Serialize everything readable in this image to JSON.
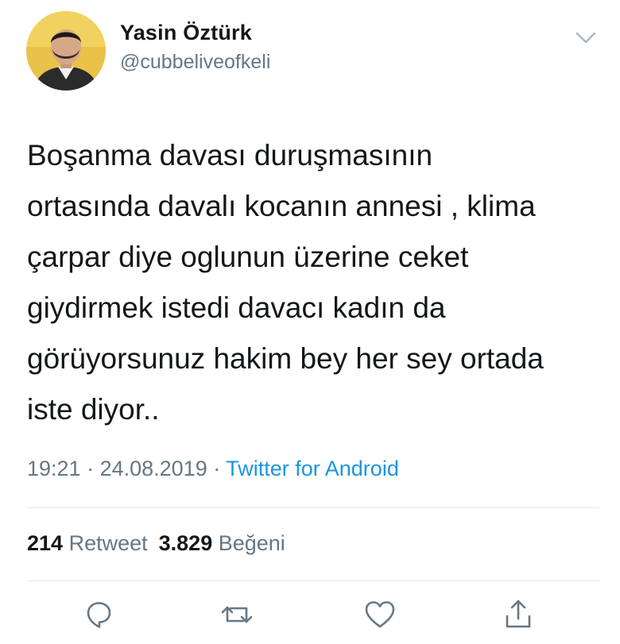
{
  "user": {
    "display_name": "Yasin Öztürk",
    "handle": "@cubbeliveofkeli"
  },
  "tweet": {
    "text": "Boşanma davası duruşmasının\nortasında davalı kocanın annesi , klima\nçarpar diye oglunun üzerine ceket\ngiydirmek istedi davacı kadın da\ngörüyorsunuz hakim bey her sey ortada\niste diyor..",
    "time": "19:21",
    "separator": " · ",
    "date": "24.08.2019",
    "source": "Twitter for Android"
  },
  "stats": {
    "retweet_count": "214",
    "retweet_label": "Retweet",
    "like_count": "3.829",
    "like_label": "Beğeni"
  },
  "colors": {
    "text": "#14171a",
    "secondary": "#657786",
    "link": "#1b95e0",
    "divider": "#e1e8ed"
  },
  "icons": {
    "menu": "chevron-down-icon",
    "reply": "reply-icon",
    "retweet": "retweet-icon",
    "like": "heart-icon",
    "share": "share-icon"
  }
}
